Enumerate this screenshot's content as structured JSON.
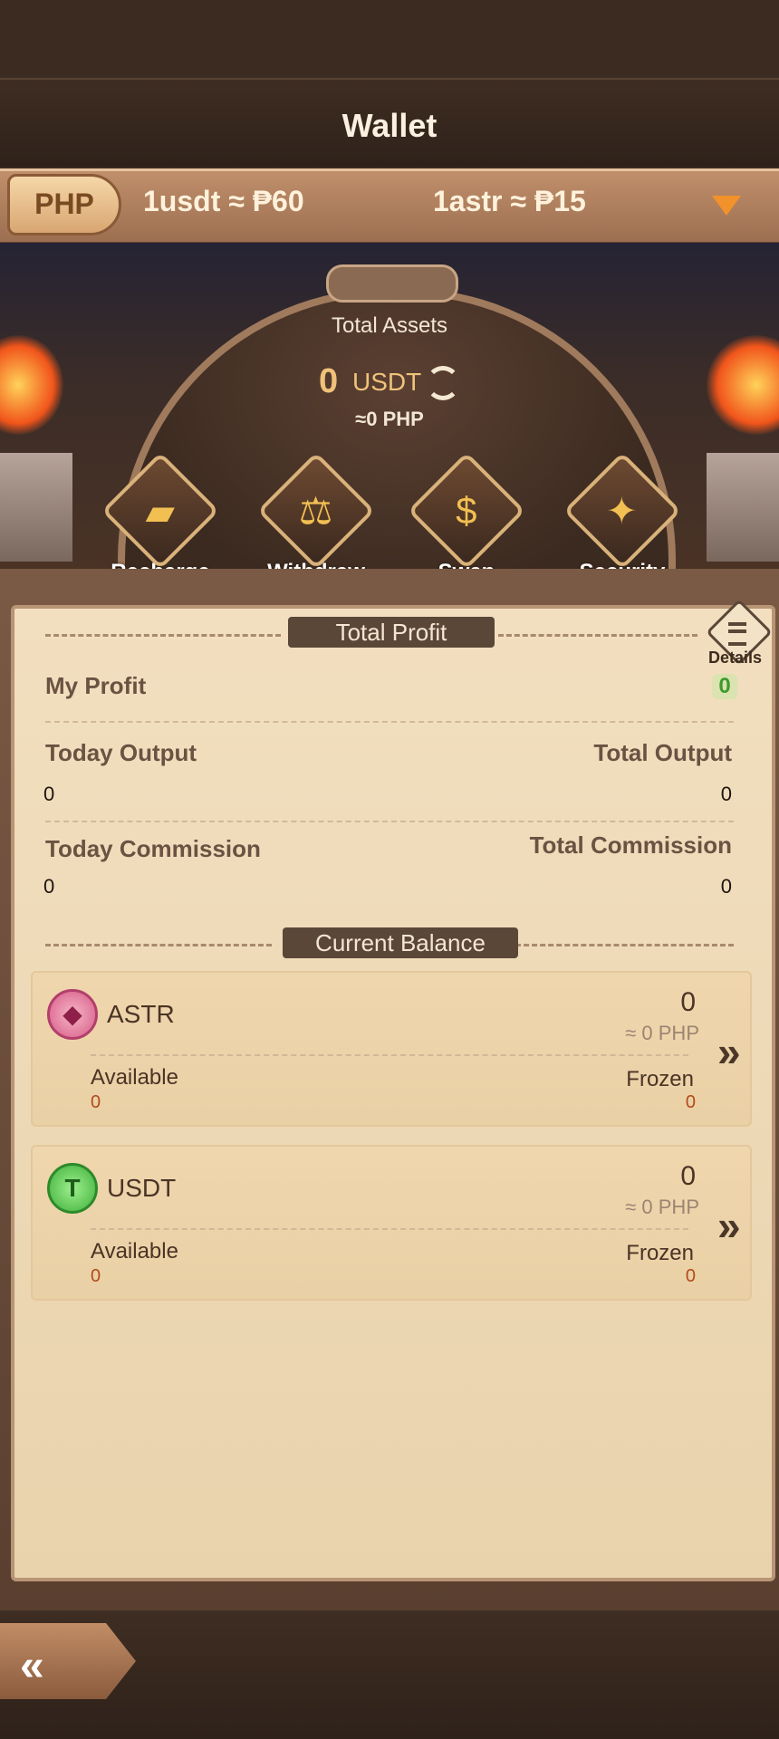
{
  "header": {
    "title": "Wallet"
  },
  "currency": {
    "selected": "PHP",
    "rate_usdt": "1usdt ≈ ₱60",
    "rate_astr": "1astr ≈ ₱15"
  },
  "assets": {
    "label": "Total Assets",
    "amount": "0",
    "unit": "USDT",
    "php_equiv": "≈0 PHP"
  },
  "actions": [
    {
      "label": "Recharge",
      "icon": "gold-bars-icon"
    },
    {
      "label": "Withdraw",
      "icon": "scale-icon"
    },
    {
      "label": "Swap",
      "icon": "money-bag-icon"
    },
    {
      "label": "Security",
      "icon": "shield-icon"
    }
  ],
  "profit": {
    "section_title": "Total Profit",
    "details_label": "Details",
    "my_profit_label": "My Profit",
    "my_profit_value": "0",
    "today_output_label": "Today Output",
    "today_output_value": "0",
    "total_output_label": "Total Output",
    "total_output_value": "0",
    "today_commission_label": "Today Commission",
    "today_commission_value": "0",
    "total_commission_label": "Total Commission",
    "total_commission_value": "0"
  },
  "balance": {
    "section_title": "Current Balance",
    "items": [
      {
        "name": "ASTR",
        "amount": "0",
        "php": "≈ 0 PHP",
        "available_label": "Available",
        "available": "0",
        "frozen_label": "Frozen",
        "frozen": "0"
      },
      {
        "name": "USDT",
        "amount": "0",
        "php": "≈ 0 PHP",
        "available_label": "Available",
        "available": "0",
        "frozen_label": "Frozen",
        "frozen": "0"
      }
    ]
  },
  "colors": {
    "accent": "#f0c27a",
    "profit_green": "#3f9a2e",
    "panel": "#f2dfbf"
  }
}
